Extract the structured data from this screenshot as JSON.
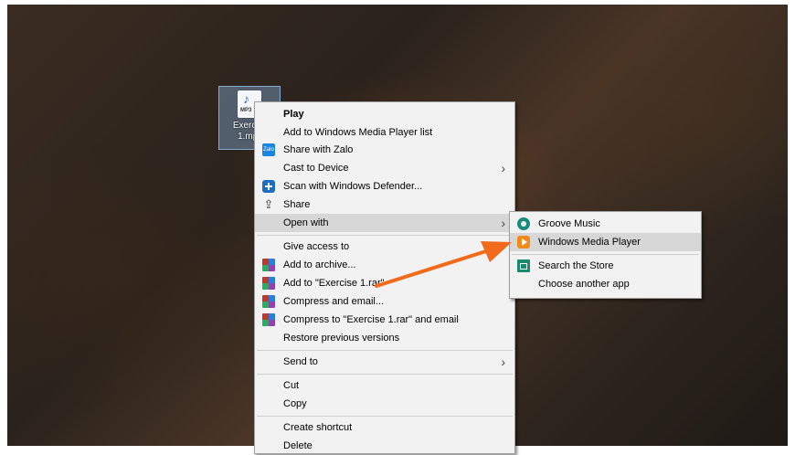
{
  "desktop": {
    "file": {
      "name_line1": "Exercise",
      "name_line2": "1.mp3",
      "type_label": "MP3"
    }
  },
  "context_menu": {
    "items": [
      {
        "label": "Play"
      },
      {
        "label": "Add to Windows Media Player list"
      },
      {
        "label": "Share with Zalo",
        "icon": "zalo-icon"
      },
      {
        "label": "Cast to Device"
      },
      {
        "label": "Scan with Windows Defender...",
        "icon": "windows-defender-icon"
      },
      {
        "label": "Share",
        "icon": "share-icon"
      },
      {
        "label": "Open with"
      },
      {
        "label": "Give access to"
      },
      {
        "label": "Add to archive...",
        "icon": "winrar-icon"
      },
      {
        "label": "Add to \"Exercise 1.rar\"",
        "icon": "winrar-icon"
      },
      {
        "label": "Compress and email...",
        "icon": "winrar-icon"
      },
      {
        "label": "Compress to \"Exercise 1.rar\" and email",
        "icon": "winrar-icon"
      },
      {
        "label": "Restore previous versions"
      },
      {
        "label": "Send to"
      },
      {
        "label": "Cut"
      },
      {
        "label": "Copy"
      },
      {
        "label": "Create shortcut"
      },
      {
        "label": "Delete"
      }
    ]
  },
  "open_with_submenu": {
    "items": [
      {
        "label": "Groove Music",
        "icon": "groove-music-icon"
      },
      {
        "label": "Windows Media Player",
        "icon": "windows-media-player-icon"
      },
      {
        "label": "Search the Store",
        "icon": "store-icon"
      },
      {
        "label": "Choose another app"
      }
    ]
  },
  "icons": {
    "chevron": "›",
    "zalo_text": "Zalo"
  },
  "colors": {
    "annotation_arrow": "#f26a1b",
    "menu_bg": "#f2f2f2",
    "highlight": "#d7d7d7"
  }
}
